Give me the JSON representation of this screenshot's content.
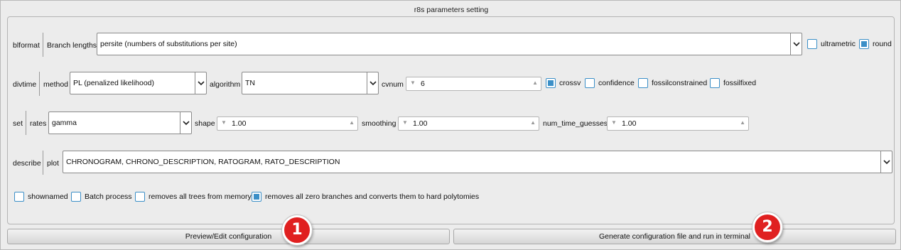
{
  "window": {
    "title": "r8s parameters setting"
  },
  "blformat": {
    "group_label": "blformat",
    "field_label": "Branch lengths",
    "value": "persite (numbers of substitutions per site)",
    "ultrametric_label": "ultrametric",
    "ultrametric_checked": false,
    "round_label": "round",
    "round_checked": true
  },
  "divtime": {
    "group_label": "divtime",
    "method_label": "method",
    "method_value": "PL (penalized likelihood)",
    "algorithm_label": "algorithm",
    "algorithm_value": "TN",
    "cvnum_label": "cvnum",
    "cvnum_value": "6",
    "crossv_label": "crossv",
    "crossv_checked": true,
    "confidence_label": "confidence",
    "confidence_checked": false,
    "fossilconstrained_label": "fossilconstrained",
    "fossilconstrained_checked": false,
    "fossilfixed_label": "fossilfixed",
    "fossilfixed_checked": false
  },
  "set": {
    "group_label": "set",
    "rates_label": "rates",
    "rates_value": "gamma",
    "shape_label": "shape",
    "shape_value": "1.00",
    "smoothing_label": "smoothing",
    "smoothing_value": "1.00",
    "guesses_label": "num_time_guesses",
    "guesses_value": "1.00"
  },
  "describe": {
    "group_label": "describe",
    "plot_label": "plot",
    "plot_value": "CHRONOGRAM, CHRONO_DESCRIPTION, RATOGRAM, RATO_DESCRIPTION"
  },
  "options": [
    {
      "label": "shownamed",
      "checked": false
    },
    {
      "label": "Batch process",
      "checked": false
    },
    {
      "label": "removes all trees from memory",
      "checked": false
    },
    {
      "label": "removes all zero branches and converts them to hard polytomies",
      "checked": true
    }
  ],
  "buttons": {
    "preview_label": "Preview/Edit configuration",
    "generate_label": "Generate configuration file and run in terminal"
  },
  "badges": {
    "one": "1",
    "two": "2",
    "color": "#e02020"
  },
  "colors": {
    "accent": "#3b8fc7",
    "background": "#ececec"
  }
}
